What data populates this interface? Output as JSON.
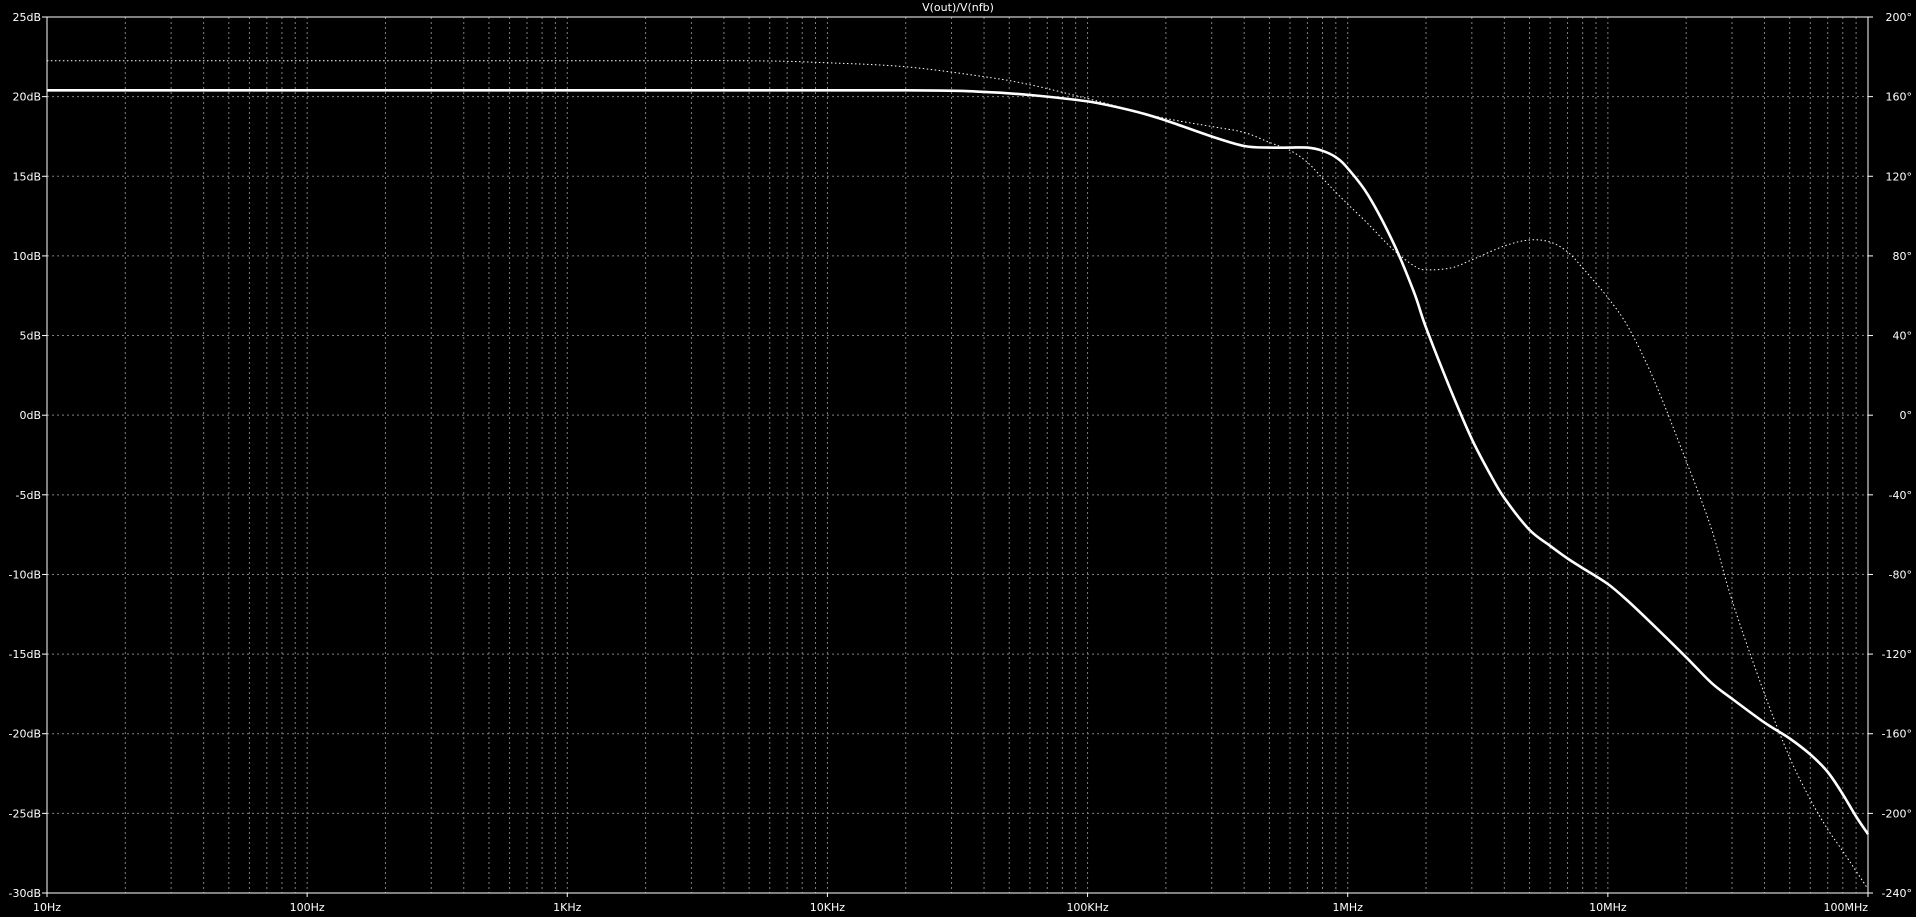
{
  "chart_data": {
    "type": "line",
    "title": "V(out)/V(nfb)",
    "x_scale": "log",
    "xlim": [
      10,
      100000000
    ],
    "x_ticks": [
      {
        "value": 10,
        "label": "10Hz"
      },
      {
        "value": 100,
        "label": "100Hz"
      },
      {
        "value": 1000,
        "label": "1KHz"
      },
      {
        "value": 10000,
        "label": "10KHz"
      },
      {
        "value": 100000,
        "label": "100KHz"
      },
      {
        "value": 1000000,
        "label": "1MHz"
      },
      {
        "value": 10000000,
        "label": "10MHz"
      },
      {
        "value": 100000000,
        "label": "100MHz"
      }
    ],
    "ylim_left": [
      -30,
      25
    ],
    "y_left_ticks": [
      {
        "value": 25,
        "label": "25dB"
      },
      {
        "value": 20,
        "label": "20dB"
      },
      {
        "value": 15,
        "label": "15dB"
      },
      {
        "value": 10,
        "label": "10dB"
      },
      {
        "value": 5,
        "label": "5dB"
      },
      {
        "value": 0,
        "label": "0dB"
      },
      {
        "value": -5,
        "label": "-5dB"
      },
      {
        "value": -10,
        "label": "-10dB"
      },
      {
        "value": -15,
        "label": "-15dB"
      },
      {
        "value": -20,
        "label": "-20dB"
      },
      {
        "value": -25,
        "label": "-25dB"
      },
      {
        "value": -30,
        "label": "-30dB"
      }
    ],
    "ylim_right": [
      -240,
      200
    ],
    "y_right_ticks": [
      {
        "value": 200,
        "label": "200°"
      },
      {
        "value": 160,
        "label": "160°"
      },
      {
        "value": 120,
        "label": "120°"
      },
      {
        "value": 80,
        "label": "80°"
      },
      {
        "value": 40,
        "label": "40°"
      },
      {
        "value": 0,
        "label": "0°"
      },
      {
        "value": -40,
        "label": "-40°"
      },
      {
        "value": -80,
        "label": "-80°"
      },
      {
        "value": -120,
        "label": "-120°"
      },
      {
        "value": -160,
        "label": "-160°"
      },
      {
        "value": -200,
        "label": "-200°"
      },
      {
        "value": -240,
        "label": "-240°"
      }
    ],
    "grid": true,
    "background_color": "#000000",
    "foreground_color": "#ffffff",
    "grid_color": "#808080",
    "series": [
      {
        "id": "magnitude",
        "axis": "left",
        "style": "solid",
        "points": [
          [
            10,
            20.4
          ],
          [
            1000,
            20.4
          ],
          [
            20000,
            20.4
          ],
          [
            40000,
            20.3
          ],
          [
            60000,
            20.1
          ],
          [
            100000,
            19.7
          ],
          [
            150000,
            19.1
          ],
          [
            200000,
            18.5
          ],
          [
            300000,
            17.5
          ],
          [
            400000,
            16.9
          ],
          [
            500000,
            16.8
          ],
          [
            600000,
            16.8
          ],
          [
            700000,
            16.8
          ],
          [
            800000,
            16.6
          ],
          [
            900000,
            16.2
          ],
          [
            1000000,
            15.5
          ],
          [
            1200000,
            13.8
          ],
          [
            1500000,
            10.8
          ],
          [
            1800000,
            7.7
          ],
          [
            2000000,
            5.5
          ],
          [
            2500000,
            1.5
          ],
          [
            3000000,
            -1.5
          ],
          [
            3500000,
            -3.6
          ],
          [
            4000000,
            -5.2
          ],
          [
            5000000,
            -7.2
          ],
          [
            6000000,
            -8.2
          ],
          [
            7000000,
            -9.0
          ],
          [
            8000000,
            -9.6
          ],
          [
            10000000,
            -10.6
          ],
          [
            12000000,
            -11.7
          ],
          [
            15000000,
            -13.2
          ],
          [
            20000000,
            -15.2
          ],
          [
            25000000,
            -16.8
          ],
          [
            30000000,
            -17.8
          ],
          [
            40000000,
            -19.3
          ],
          [
            50000000,
            -20.3
          ],
          [
            60000000,
            -21.3
          ],
          [
            70000000,
            -22.4
          ],
          [
            80000000,
            -23.8
          ],
          [
            90000000,
            -25.2
          ],
          [
            100000000,
            -26.3
          ]
        ]
      },
      {
        "id": "phase",
        "axis": "right",
        "style": "dotted",
        "points": [
          [
            10,
            178
          ],
          [
            1000,
            178
          ],
          [
            5000,
            178
          ],
          [
            10000,
            177
          ],
          [
            20000,
            175
          ],
          [
            40000,
            170
          ],
          [
            60000,
            166
          ],
          [
            100000,
            159
          ],
          [
            150000,
            153
          ],
          [
            200000,
            149
          ],
          [
            300000,
            145
          ],
          [
            400000,
            142
          ],
          [
            500000,
            137
          ],
          [
            600000,
            133
          ],
          [
            700000,
            127
          ],
          [
            800000,
            119
          ],
          [
            900000,
            112
          ],
          [
            1000000,
            106
          ],
          [
            1200000,
            96
          ],
          [
            1500000,
            83
          ],
          [
            1800000,
            75
          ],
          [
            2000000,
            73
          ],
          [
            2500000,
            74
          ],
          [
            3000000,
            78
          ],
          [
            4000000,
            85
          ],
          [
            5000000,
            88
          ],
          [
            6000000,
            87
          ],
          [
            7000000,
            82
          ],
          [
            8000000,
            74
          ],
          [
            10000000,
            59
          ],
          [
            12000000,
            44
          ],
          [
            15000000,
            18
          ],
          [
            20000000,
            -23
          ],
          [
            25000000,
            -57
          ],
          [
            30000000,
            -93
          ],
          [
            40000000,
            -140
          ],
          [
            50000000,
            -172
          ],
          [
            60000000,
            -193
          ],
          [
            70000000,
            -208
          ],
          [
            80000000,
            -219
          ],
          [
            100000000,
            -238
          ]
        ]
      }
    ]
  }
}
